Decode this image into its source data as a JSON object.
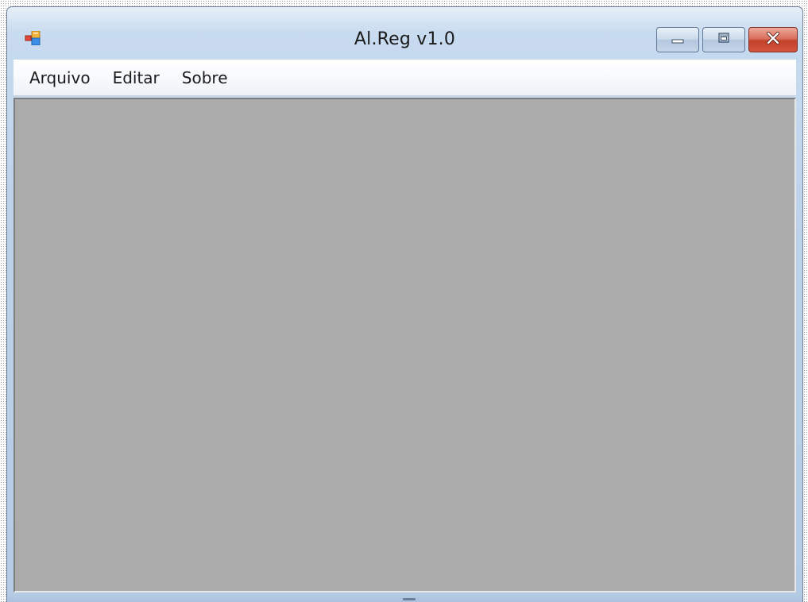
{
  "window": {
    "title": "Al.Reg v1.0",
    "icon": "windows-forms-app-icon",
    "caption_buttons": [
      "minimize-icon",
      "maximize-icon",
      "close-icon"
    ]
  },
  "menu": {
    "items": [
      {
        "label": "Arquivo"
      },
      {
        "label": "Editar"
      },
      {
        "label": "Sobre"
      }
    ]
  },
  "colors": {
    "client_area": "#ababab",
    "title_glass": "#c9dcf0",
    "close_button": "#c2412a"
  }
}
